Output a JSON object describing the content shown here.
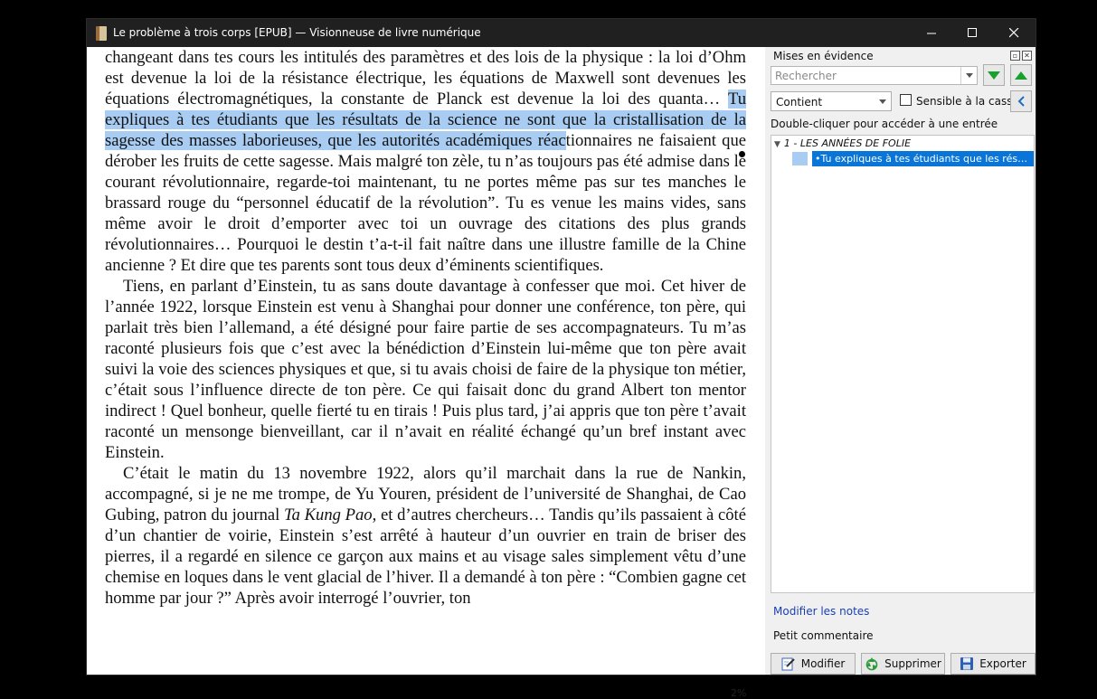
{
  "window": {
    "title": "Le problème à trois corps [EPUB] — Visionneuse de livre numérique",
    "controls": {
      "minimize": "—",
      "maximize": "☐",
      "close": "✕"
    }
  },
  "reader": {
    "paragraph1_before": "changeant dans tes cours les intitulés des paramètres et des lois de la physique : la loi d’Ohm est devenue la loi de la résistance électrique, les équations de Maxwell sont devenues les équations électromagnétiques, la constante de Planck est devenue la loi des quanta… ",
    "paragraph1_highlight": "Tu expliques à tes étudiants que les résultats de la science ne sont que la cristallisation de la sagesse des masses laborieuses, que les autorités académiques réac",
    "paragraph1_after": "tionnaires ne faisaient que dérober les fruits de cette sagesse. Mais malgré ton zèle, tu n’as toujours pas été admise dans le courant révolutionnaire, regarde-toi maintenant, tu ne portes même pas sur tes manches le brassard rouge du “personnel éducatif de la révolution”. Tu es venue les mains vides, sans même avoir le droit d’emporter avec toi un ouvrage des citations des plus grands révolutionnaires… Pourquoi le destin t’a-t-il fait naître dans une illustre famille de la Chine ancienne ? Et dire que tes parents sont tous deux d’éminents scientifiques.",
    "paragraph2": "Tiens, en parlant d’Einstein, tu as sans doute davantage à confesser que moi. Cet hiver de l’année 1922, lorsque Einstein est venu à Shanghai pour donner une conférence, ton père, qui parlait très bien l’allemand, a été désigné pour faire partie de ses accompagnateurs. Tu m’as raconté plusieurs fois que c’est avec la bénédiction d’Einstein lui-même que ton père avait suivi la voie des sciences physiques et que, si tu avais choisi de faire de la physique ton métier, c’était sous l’influence directe de ton père. Ce qui faisait donc du grand Albert ton mentor indirect ! Quel bonheur, quelle fierté tu en tirais ! Puis plus tard, j’ai appris que ton père t’avait raconté un mensonge bienveillant, car il n’avait en réalité échangé qu’un bref instant avec Einstein.",
    "paragraph3_before": "C’était le matin du 13 novembre 1922, alors qu’il marchait dans la rue de Nankin, accompagné, si je ne me trompe, de Yu Youren, président de l’université de Shanghai, de Cao Gubing, patron du journal ",
    "paragraph3_italic": "Ta Kung Pao",
    "paragraph3_after": ", et d’autres chercheurs… Tandis qu’ils passaient à côté d’un chantier de voirie, Einstein s’est arrêté à hauteur d’un ouvrier en train de briser des pierres, il a regardé en silence ce garçon aux mains et au visage sales simplement vêtu d’une chemise en loques dans le vent glacial de l’hiver. Il a demandé à ton père : “Combien gagne cet homme par jour ?” Après avoir interrogé l’ouvrier, ton",
    "progress": "2%"
  },
  "highlights_panel": {
    "title": "Mises en évidence",
    "search_placeholder": "Rechercher",
    "mode": "Contient",
    "case_sensitive_label": "Sensible à la casse",
    "case_sensitive_checked": false,
    "hint": "Double-cliquer pour accéder à une entrée",
    "chapter": "1 - LES ANNÉES DE FOLIE",
    "entries": [
      {
        "text": "Tu expliques à tes étudiants que les résultats de la science ne sont que la cristallisation de la sagesse des masses laborieuses",
        "color": "#a9cdf2",
        "selected": true
      }
    ],
    "edit_notes_link": "Modifier les notes",
    "comment_label": "Petit commentaire",
    "buttons": {
      "modify": "Modifier",
      "delete": "Supprimer",
      "export": "Exporter"
    }
  },
  "colors": {
    "highlight": "#a9cdf2",
    "selection": "#0a75d8",
    "nav_green": "#18a12c",
    "link_blue": "#1a3fb5"
  }
}
